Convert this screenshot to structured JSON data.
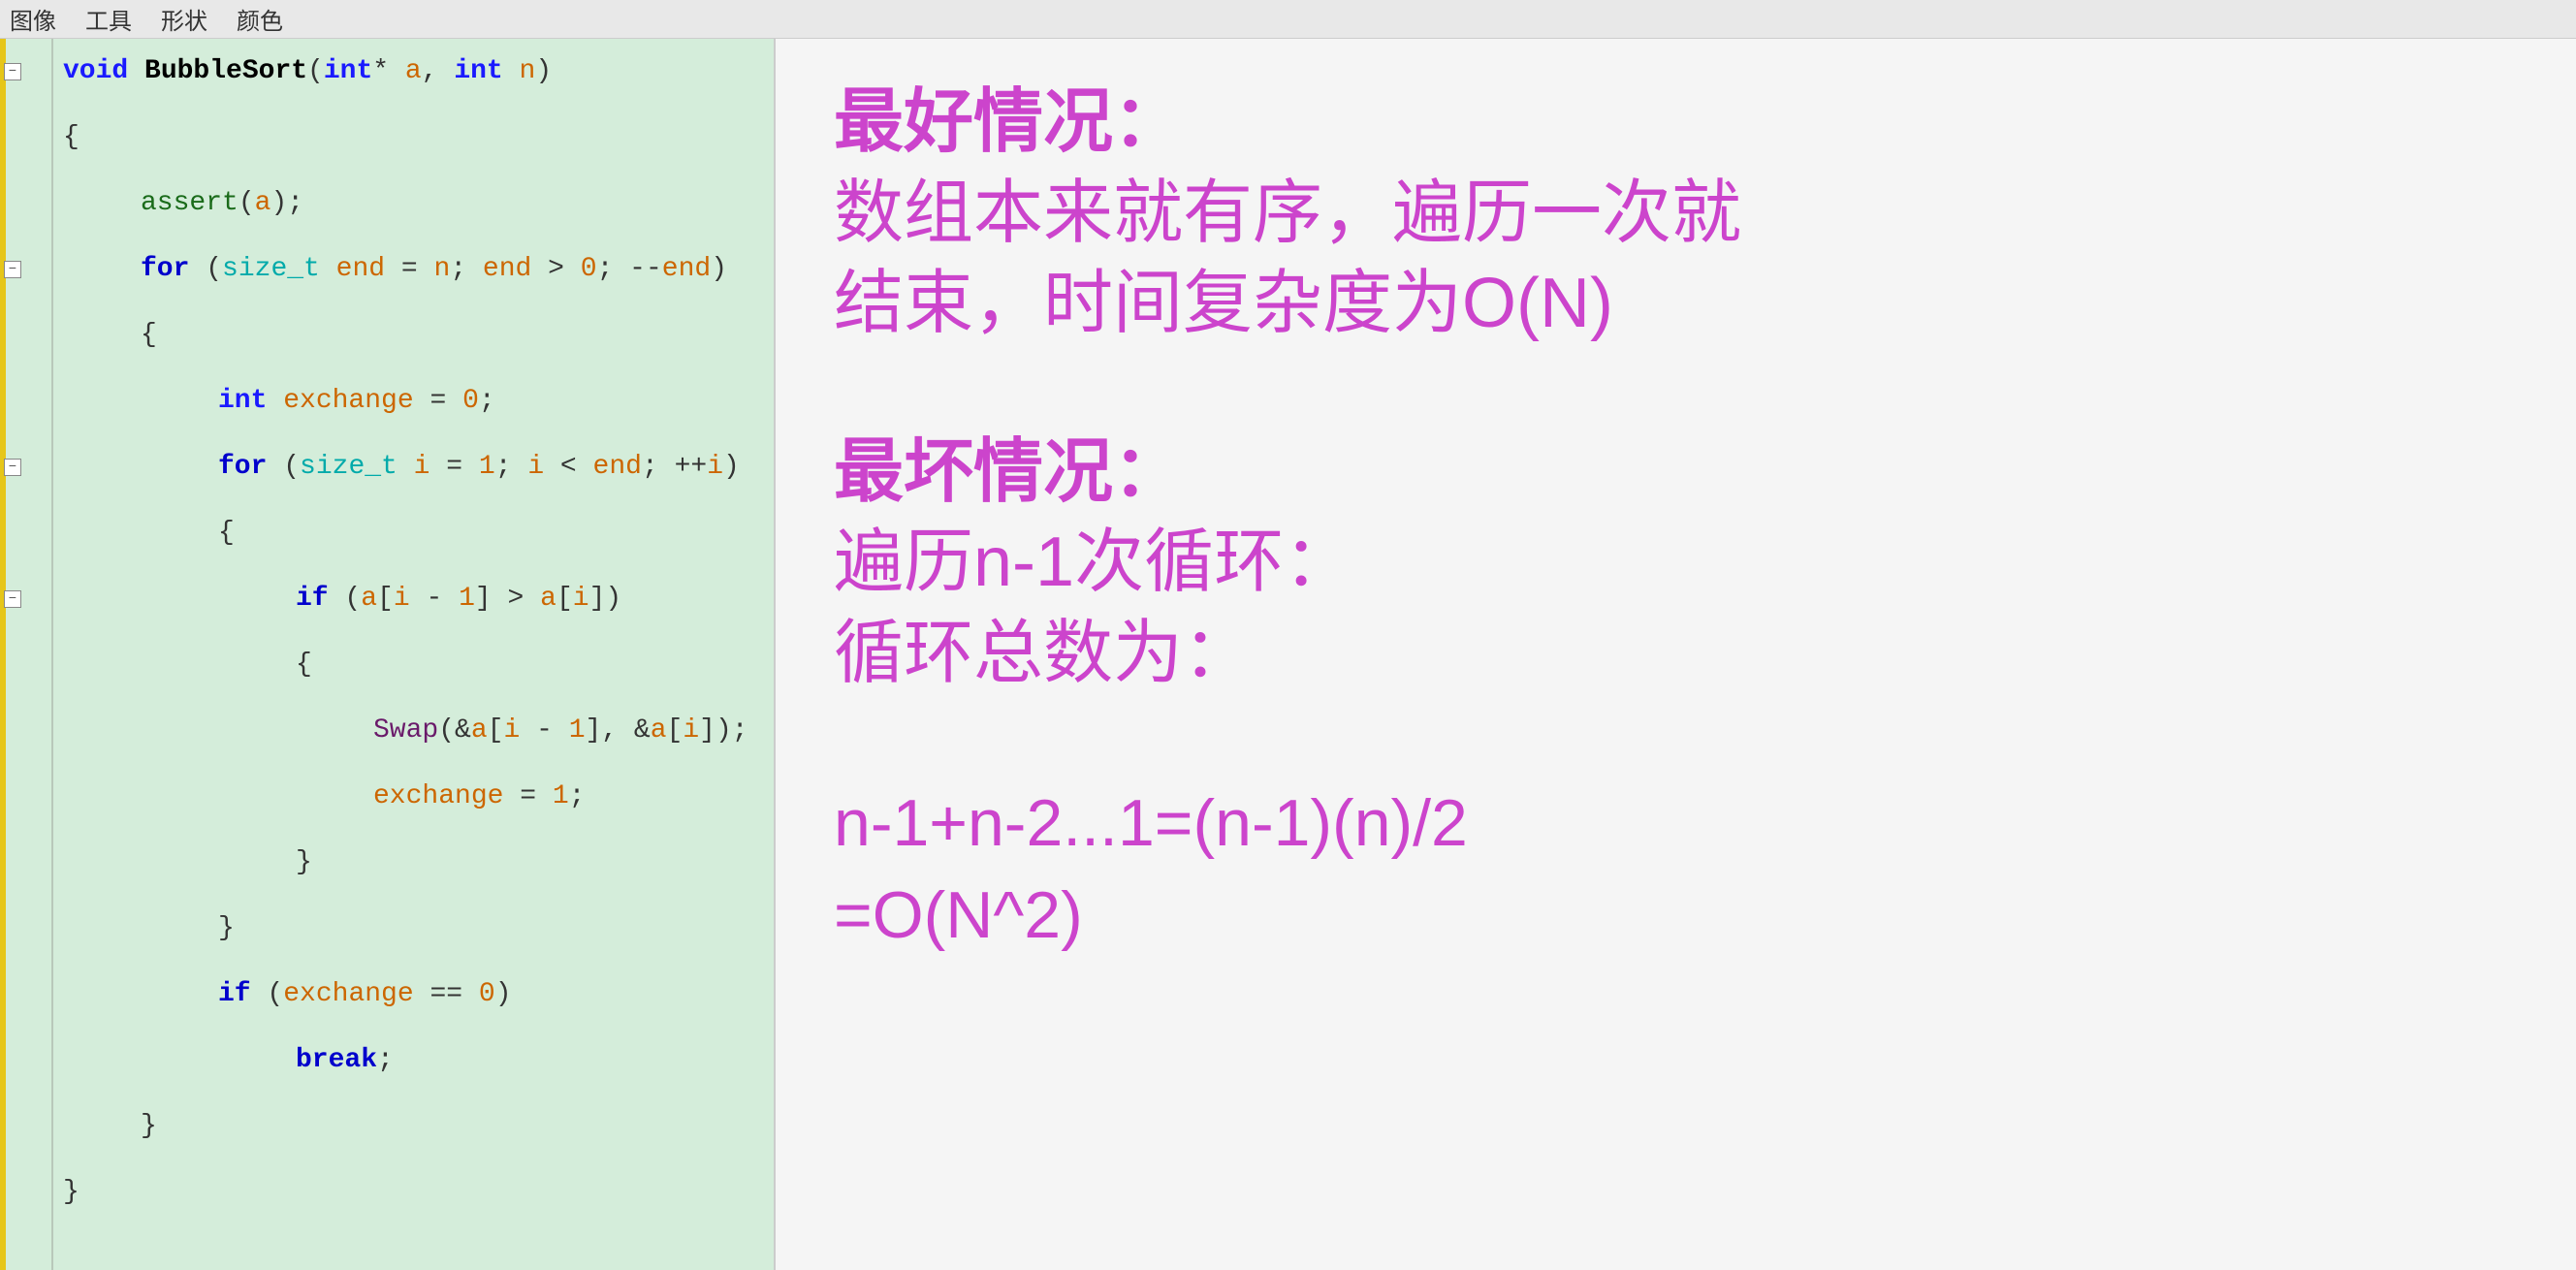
{
  "menu": {
    "items": [
      "图像",
      "工具",
      "形状",
      "颜色"
    ]
  },
  "code": {
    "function_signature": "void BubbleSort(int* a, int n)",
    "lines": [
      {
        "indent": 0,
        "content": "void BubbleSort(int* a, int n)",
        "has_collapse": true,
        "collapse_open": true
      },
      {
        "indent": 1,
        "content": "{",
        "has_collapse": false
      },
      {
        "indent": 2,
        "content": "assert(a);",
        "has_collapse": false
      },
      {
        "indent": 2,
        "content": "for (size_t end = n; end > 0; --end)",
        "has_collapse": true,
        "collapse_open": true
      },
      {
        "indent": 2,
        "content": "{",
        "has_collapse": false
      },
      {
        "indent": 3,
        "content": "int exchange = 0;",
        "has_collapse": false
      },
      {
        "indent": 3,
        "content": "for (size_t i = 1; i < end; ++i)",
        "has_collapse": true,
        "collapse_open": true
      },
      {
        "indent": 3,
        "content": "{",
        "has_collapse": false
      },
      {
        "indent": 4,
        "content": "if (a[i - 1] > a[i])",
        "has_collapse": true,
        "collapse_open": true
      },
      {
        "indent": 4,
        "content": "{",
        "has_collapse": false
      },
      {
        "indent": 5,
        "content": "Swap(&a[i - 1], &a[i]);",
        "has_collapse": false
      },
      {
        "indent": 5,
        "content": "exchange = 1;",
        "has_collapse": false
      },
      {
        "indent": 4,
        "content": "}",
        "has_collapse": false
      },
      {
        "indent": 3,
        "content": "}",
        "has_collapse": false
      },
      {
        "indent": 3,
        "content": "if (exchange == 0)",
        "has_collapse": false
      },
      {
        "indent": 4,
        "content": "break;",
        "has_collapse": false
      },
      {
        "indent": 2,
        "content": "}",
        "has_collapse": false
      },
      {
        "indent": 1,
        "content": "}",
        "has_collapse": false
      }
    ]
  },
  "annotations": {
    "best_case_title": "最好情况：",
    "best_case_text1": "数组本来就有序，遍历一次就",
    "best_case_text2": "结束，时间复杂度为O(N)",
    "worst_case_title": "最坏情况：",
    "worst_case_text1": "遍历n-1次循环：",
    "worst_case_text2": "循环总数为：",
    "math_formula1": "n-1+n-2...1=(n-1)(n)/2",
    "math_formula2": "=O(N^2)"
  }
}
